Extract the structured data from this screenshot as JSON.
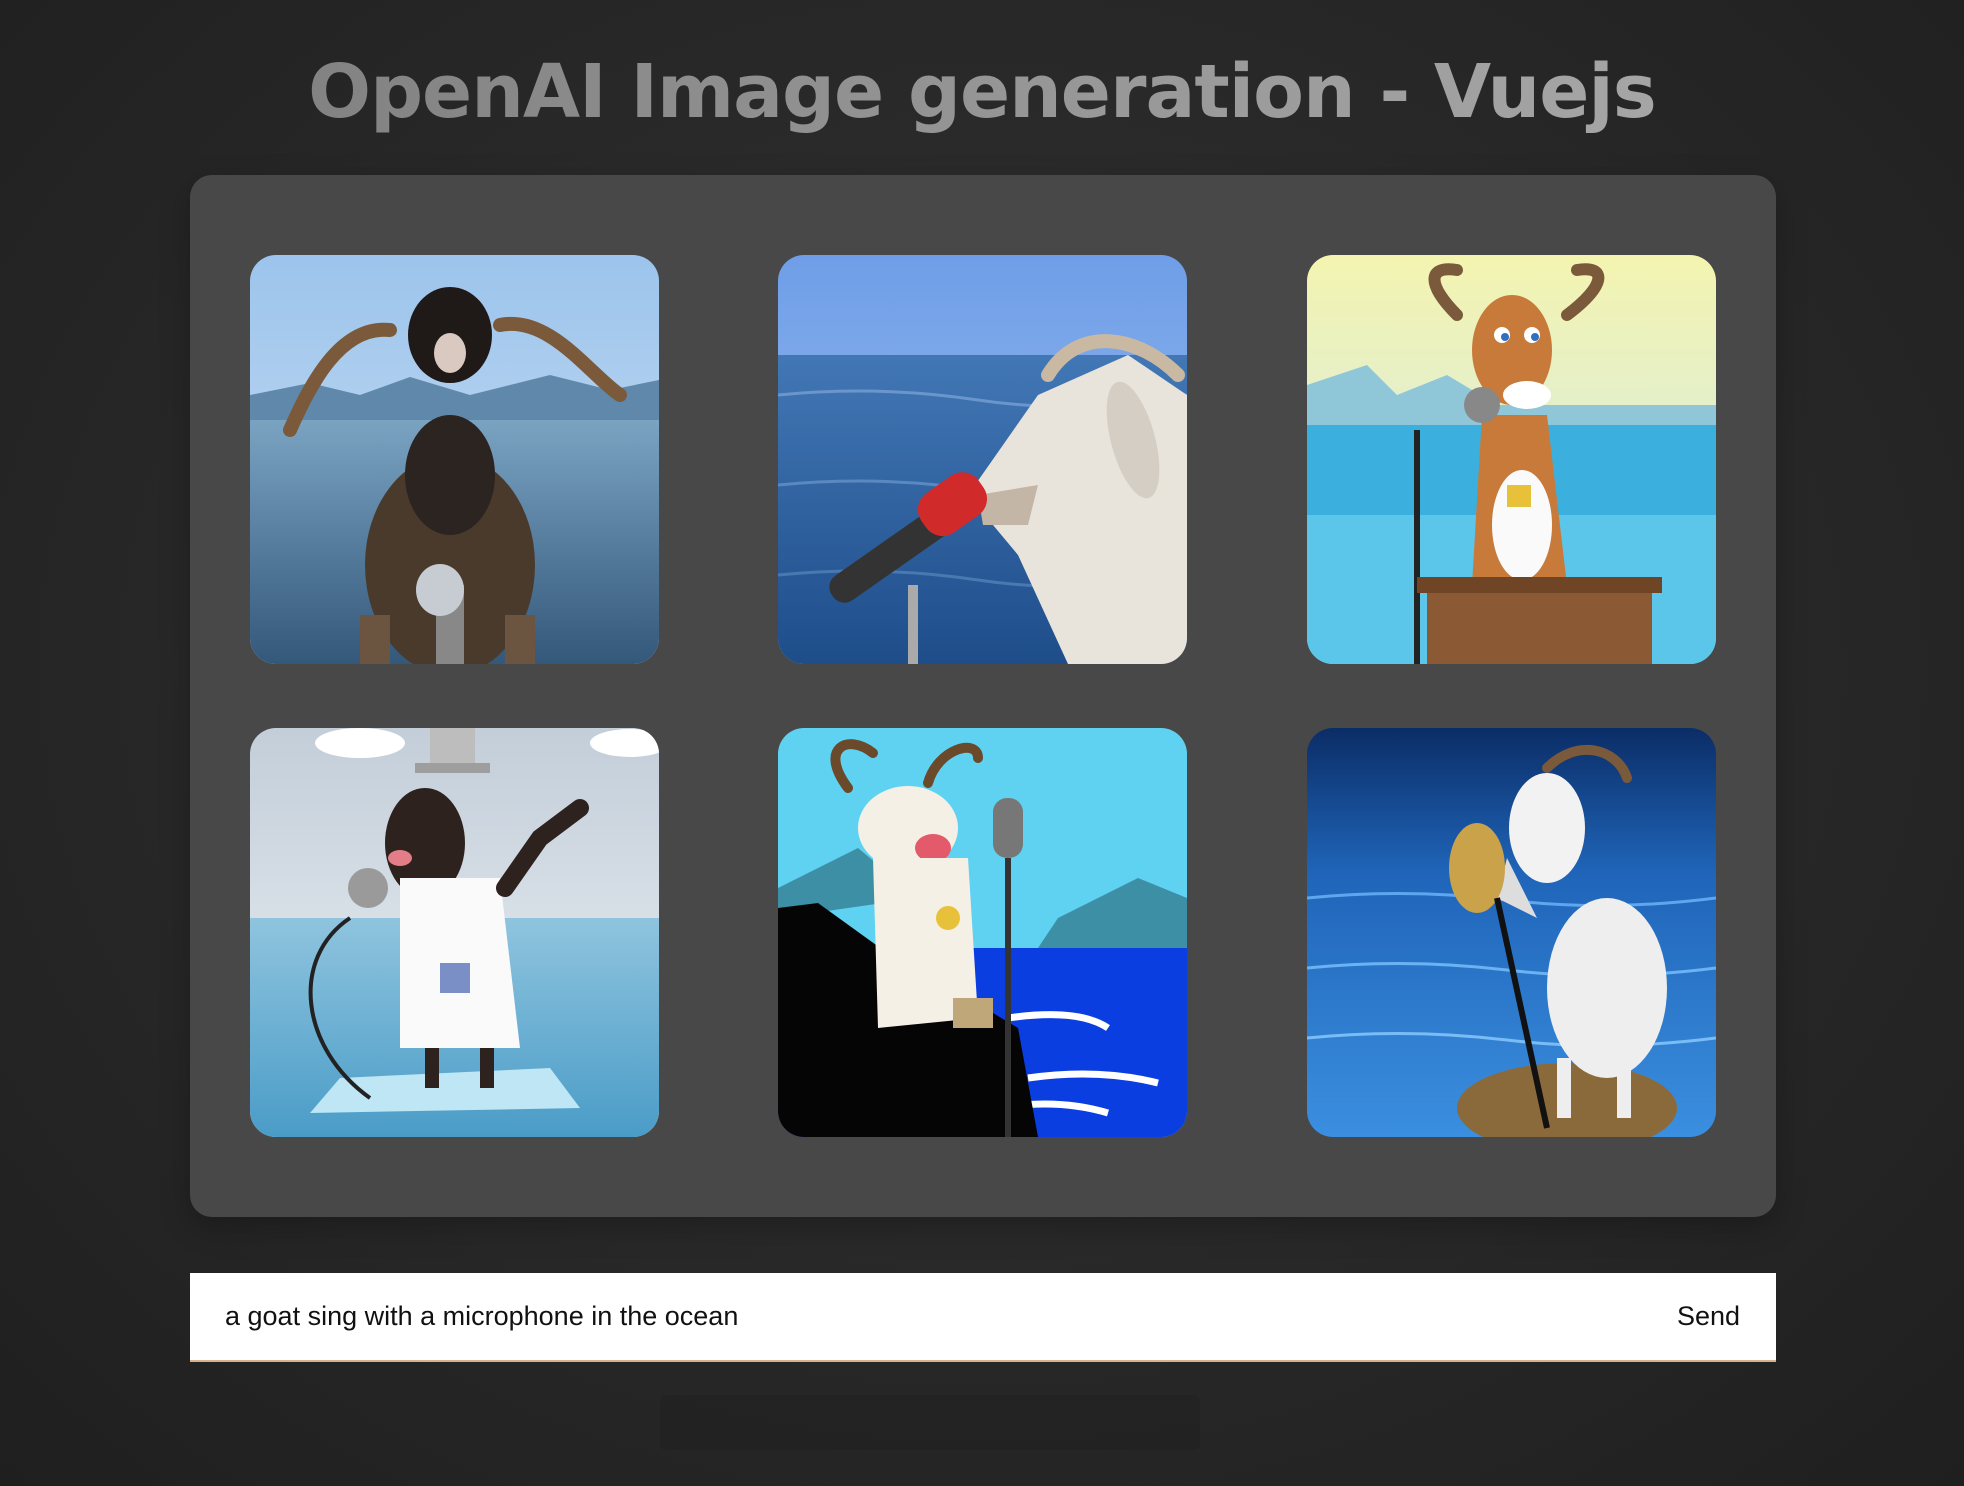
{
  "header": {
    "title": "OpenAI Image generation - Vuejs"
  },
  "gallery": {
    "images": [
      {
        "alt": "goat singing microphone ocean 1"
      },
      {
        "alt": "goat singing microphone ocean 2"
      },
      {
        "alt": "goat singing microphone ocean 3"
      },
      {
        "alt": "goat singing microphone ocean 4"
      },
      {
        "alt": "goat singing microphone ocean 5"
      },
      {
        "alt": "goat singing microphone ocean 6"
      }
    ]
  },
  "prompt": {
    "value": "a goat sing with a microphone in the ocean",
    "send_label": "Send"
  },
  "colors": {
    "background": "#2a2a2a",
    "gallery_panel": "#484848",
    "input_background": "#ffffff",
    "title": "#959595"
  }
}
